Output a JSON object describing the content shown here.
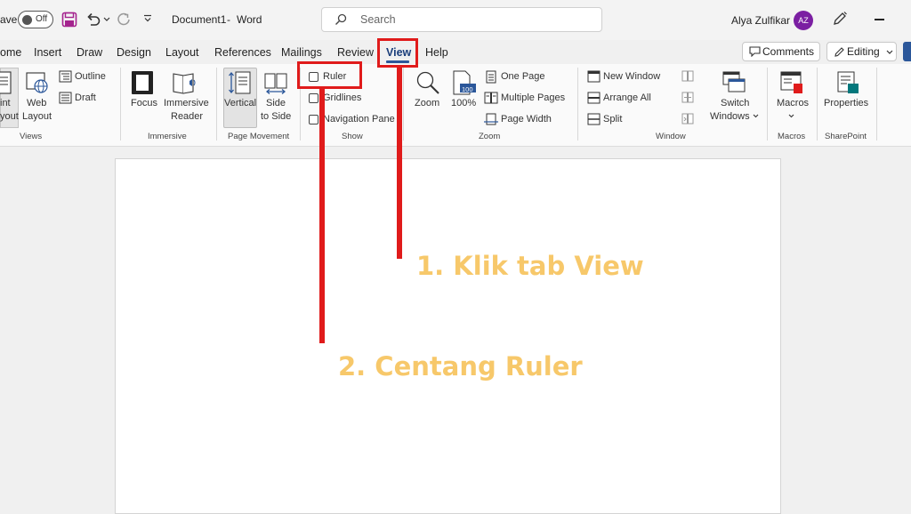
{
  "titlebar": {
    "autosave_label": "ave",
    "autosave_state": "Off",
    "document_title": "Document1",
    "separator": "-",
    "app_name": "Word",
    "search_placeholder": "Search",
    "user_name": "Alya Zulfikar",
    "user_initials": "AZ"
  },
  "tabs": [
    "ome",
    "Insert",
    "Draw",
    "Design",
    "Layout",
    "References",
    "Mailings",
    "Review",
    "View",
    "Help"
  ],
  "actions": {
    "comments": "Comments",
    "editing": "Editing"
  },
  "ribbon": {
    "views": {
      "print_layout": [
        "int",
        "yout"
      ],
      "web_layout": [
        "Web",
        "Layout"
      ],
      "outline": "Outline",
      "draft": "Draft",
      "group": "Views"
    },
    "immersive": {
      "focus": "Focus",
      "immersive_reader": [
        "Immersive",
        "Reader"
      ],
      "group": "Immersive"
    },
    "page_movement": {
      "vertical": "Vertical",
      "side_to_side": [
        "Side",
        "to Side"
      ],
      "group": "Page Movement"
    },
    "show": {
      "ruler": "Ruler",
      "gridlines": "Gridlines",
      "navigation_pane": "Navigation Pane",
      "group": "Show"
    },
    "zoom": {
      "zoom": "Zoom",
      "hundred": "100%",
      "hundred_icon": "100",
      "one_page": "One Page",
      "multiple_pages": "Multiple Pages",
      "page_width": "Page Width",
      "group": "Zoom"
    },
    "window": {
      "new_window": "New Window",
      "arrange_all": "Arrange All",
      "split": "Split",
      "switch_windows": [
        "Switch",
        "Windows"
      ],
      "group": "Window"
    },
    "macros": {
      "macros": "Macros",
      "group": "Macros"
    },
    "sharepoint": {
      "properties": "Properties",
      "group": "SharePoint"
    }
  },
  "annotations": {
    "step1": "1. Klik tab View",
    "step2": "2. Centang Ruler"
  },
  "colors": {
    "accent": "#2b579a",
    "annotation_red": "#e01b1b",
    "annotation_text": "#f7c86a",
    "avatar": "#7b1fa2",
    "save_icon": "#a4238e"
  }
}
